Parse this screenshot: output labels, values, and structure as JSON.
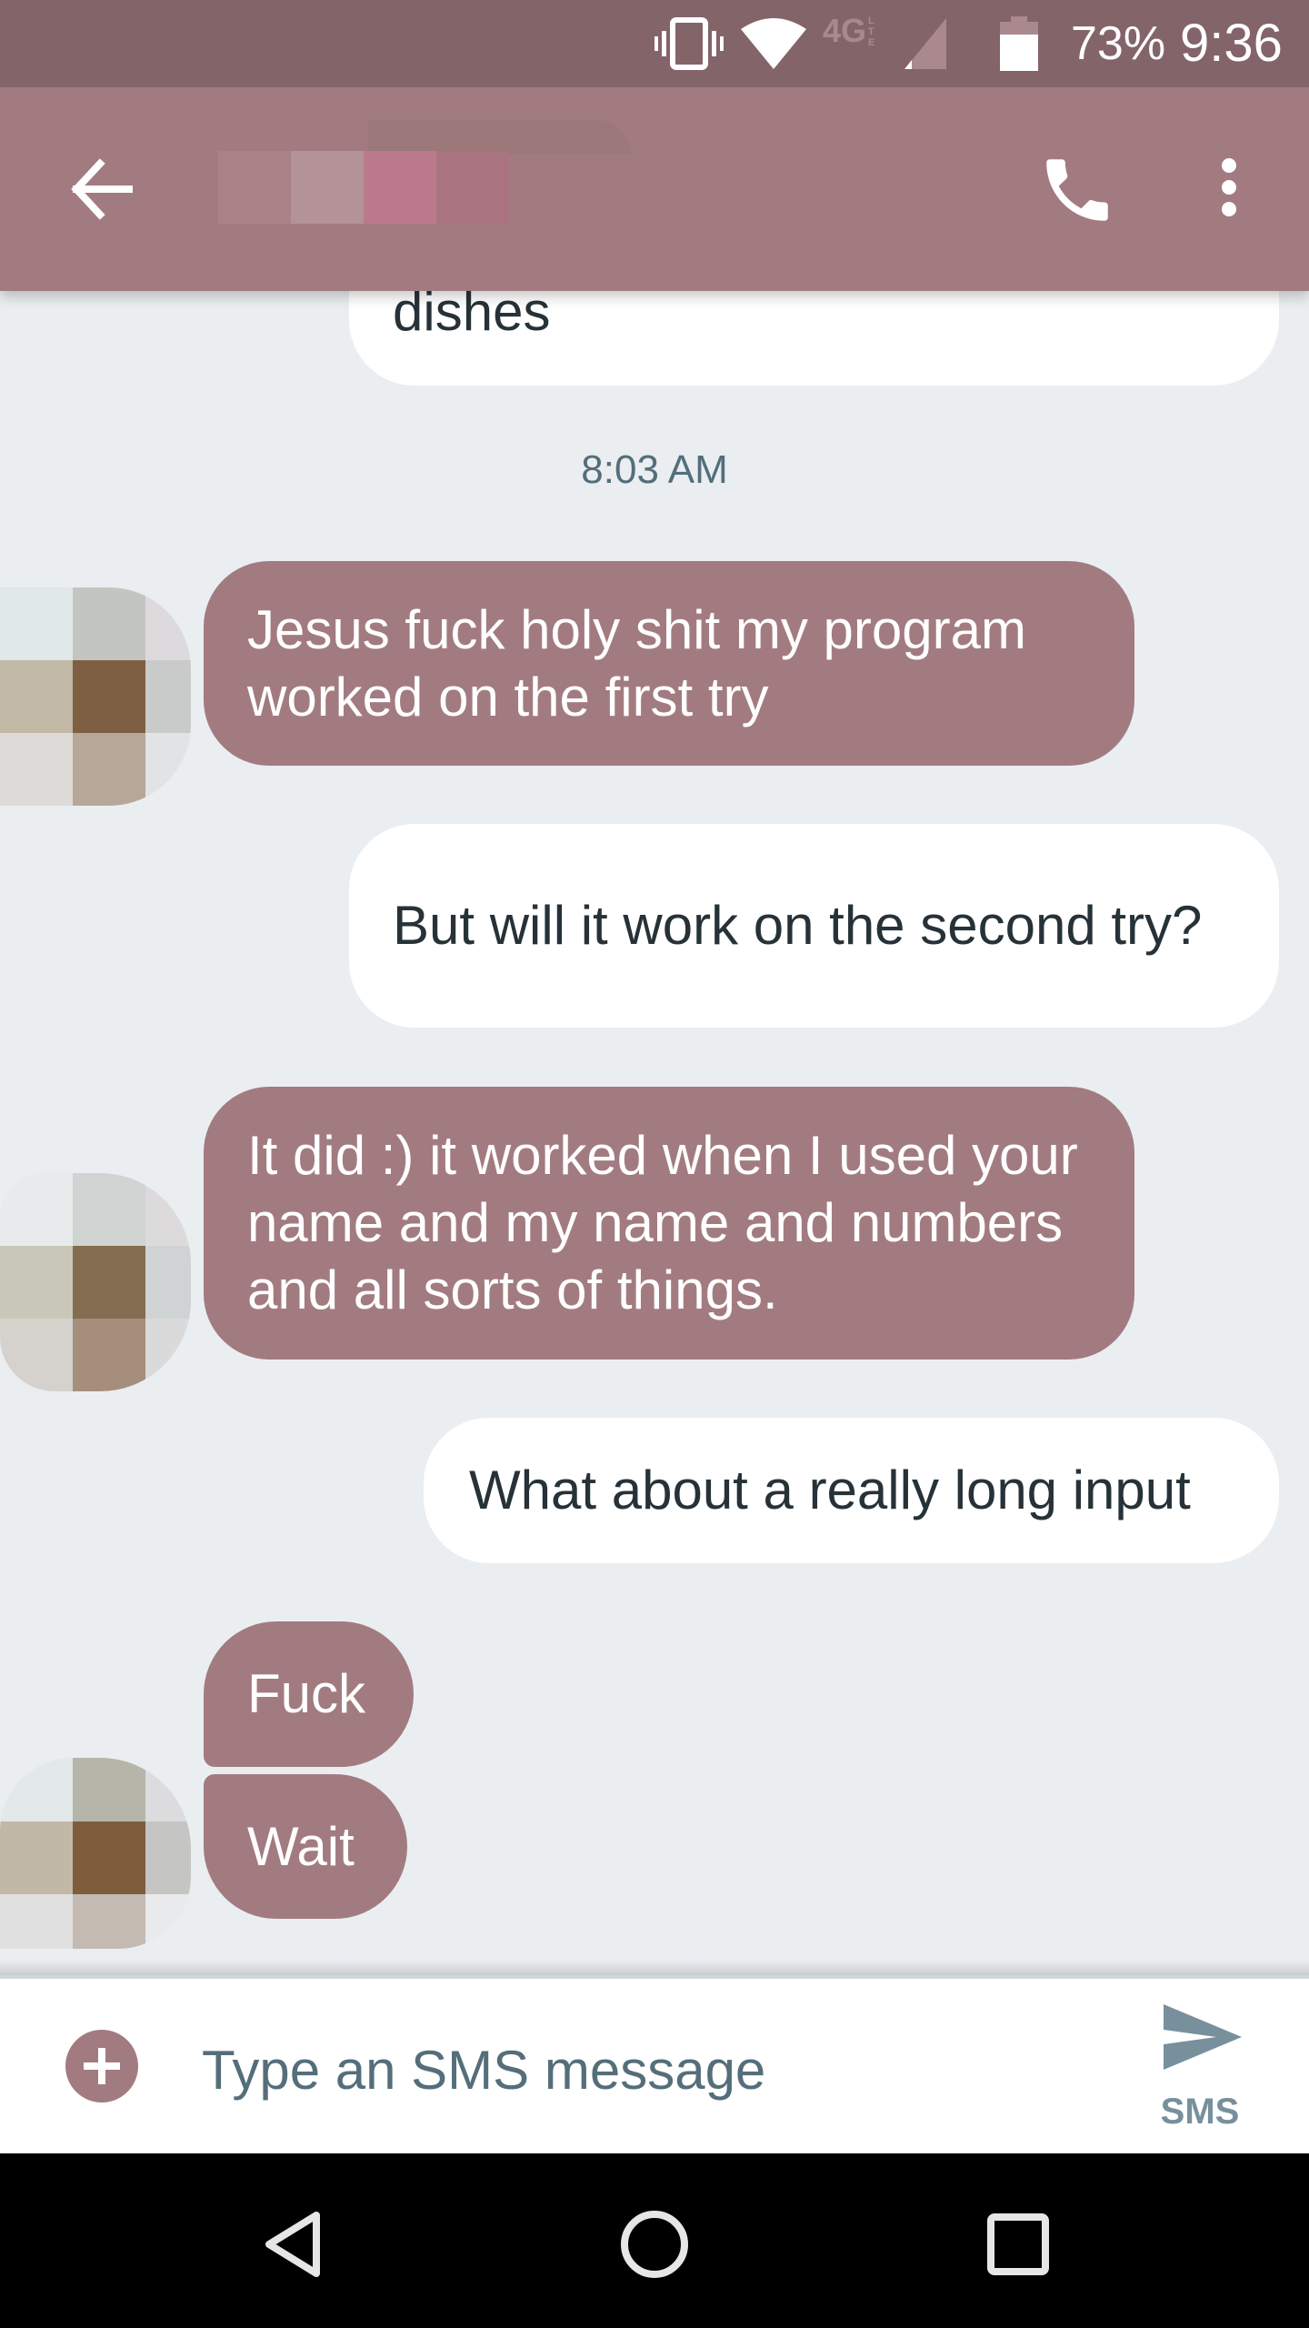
{
  "status_bar": {
    "battery_percent": "73%",
    "time": "9:36",
    "network_label": "4G LTE",
    "icons": [
      "vibrate-icon",
      "wifi-icon",
      "lte-icon",
      "signal-icon",
      "battery-icon"
    ],
    "battery_level": 0.73,
    "color": "#836469"
  },
  "app_bar": {
    "contact_name_redacted": true,
    "back_icon": "arrow-left-icon",
    "call_icon": "phone-icon",
    "menu_icon": "more-vert-icon",
    "color": "#A27B80"
  },
  "conversation": {
    "messages": [
      {
        "direction": "outgoing",
        "text": "dishes",
        "partial": true
      },
      {
        "type": "timestamp",
        "text": "8:03 AM"
      },
      {
        "direction": "incoming",
        "text": "Jesus fuck holy shit my program worked on the first try"
      },
      {
        "direction": "outgoing",
        "text": "But will it work on the second try?"
      },
      {
        "direction": "incoming",
        "text": "It did :) it worked when I used your name and my name and numbers and all sorts of things."
      },
      {
        "direction": "outgoing",
        "text": "What about a really long input"
      },
      {
        "direction": "incoming",
        "text": "Fuck"
      },
      {
        "direction": "incoming",
        "text": "Wait"
      }
    ],
    "incoming_bubble_color": "#A27B80",
    "outgoing_bubble_color": "#FFFFFF",
    "background_color": "#EAEEF1"
  },
  "compose": {
    "placeholder": "Type an SMS message",
    "value": "",
    "send_label": "SMS",
    "attach_icon": "add-circle-icon",
    "send_icon": "send-icon"
  },
  "nav_bar": {
    "buttons": [
      "back-triangle-icon",
      "home-circle-icon",
      "recents-square-icon"
    ]
  }
}
